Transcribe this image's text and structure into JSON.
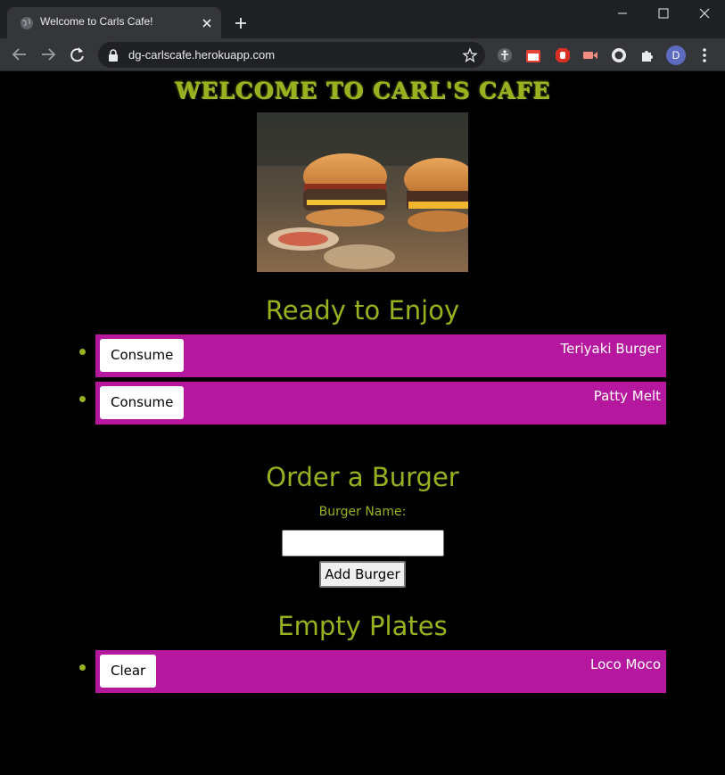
{
  "browser": {
    "tab_title": "Welcome to Carls Cafe!",
    "url": "dg-carlscafe.herokuapp.com",
    "profile_initial": "D"
  },
  "page": {
    "banner": "WELCOME TO CARL'S CAFE",
    "ready_section": {
      "title": "Ready to Enjoy",
      "items": [
        {
          "button_label": "Consume",
          "name": "Teriyaki Burger"
        },
        {
          "button_label": "Consume",
          "name": "Patty Melt"
        }
      ]
    },
    "order_section": {
      "title": "Order a Burger",
      "input_label": "Burger Name:",
      "input_value": "",
      "submit_label": "Add Burger"
    },
    "empty_section": {
      "title": "Empty Plates",
      "items": [
        {
          "button_label": "Clear",
          "name": "Loco Moco"
        }
      ]
    }
  },
  "colors": {
    "accent": "#9ab01f",
    "item_background": "#b5179f",
    "page_background": "#000000"
  }
}
